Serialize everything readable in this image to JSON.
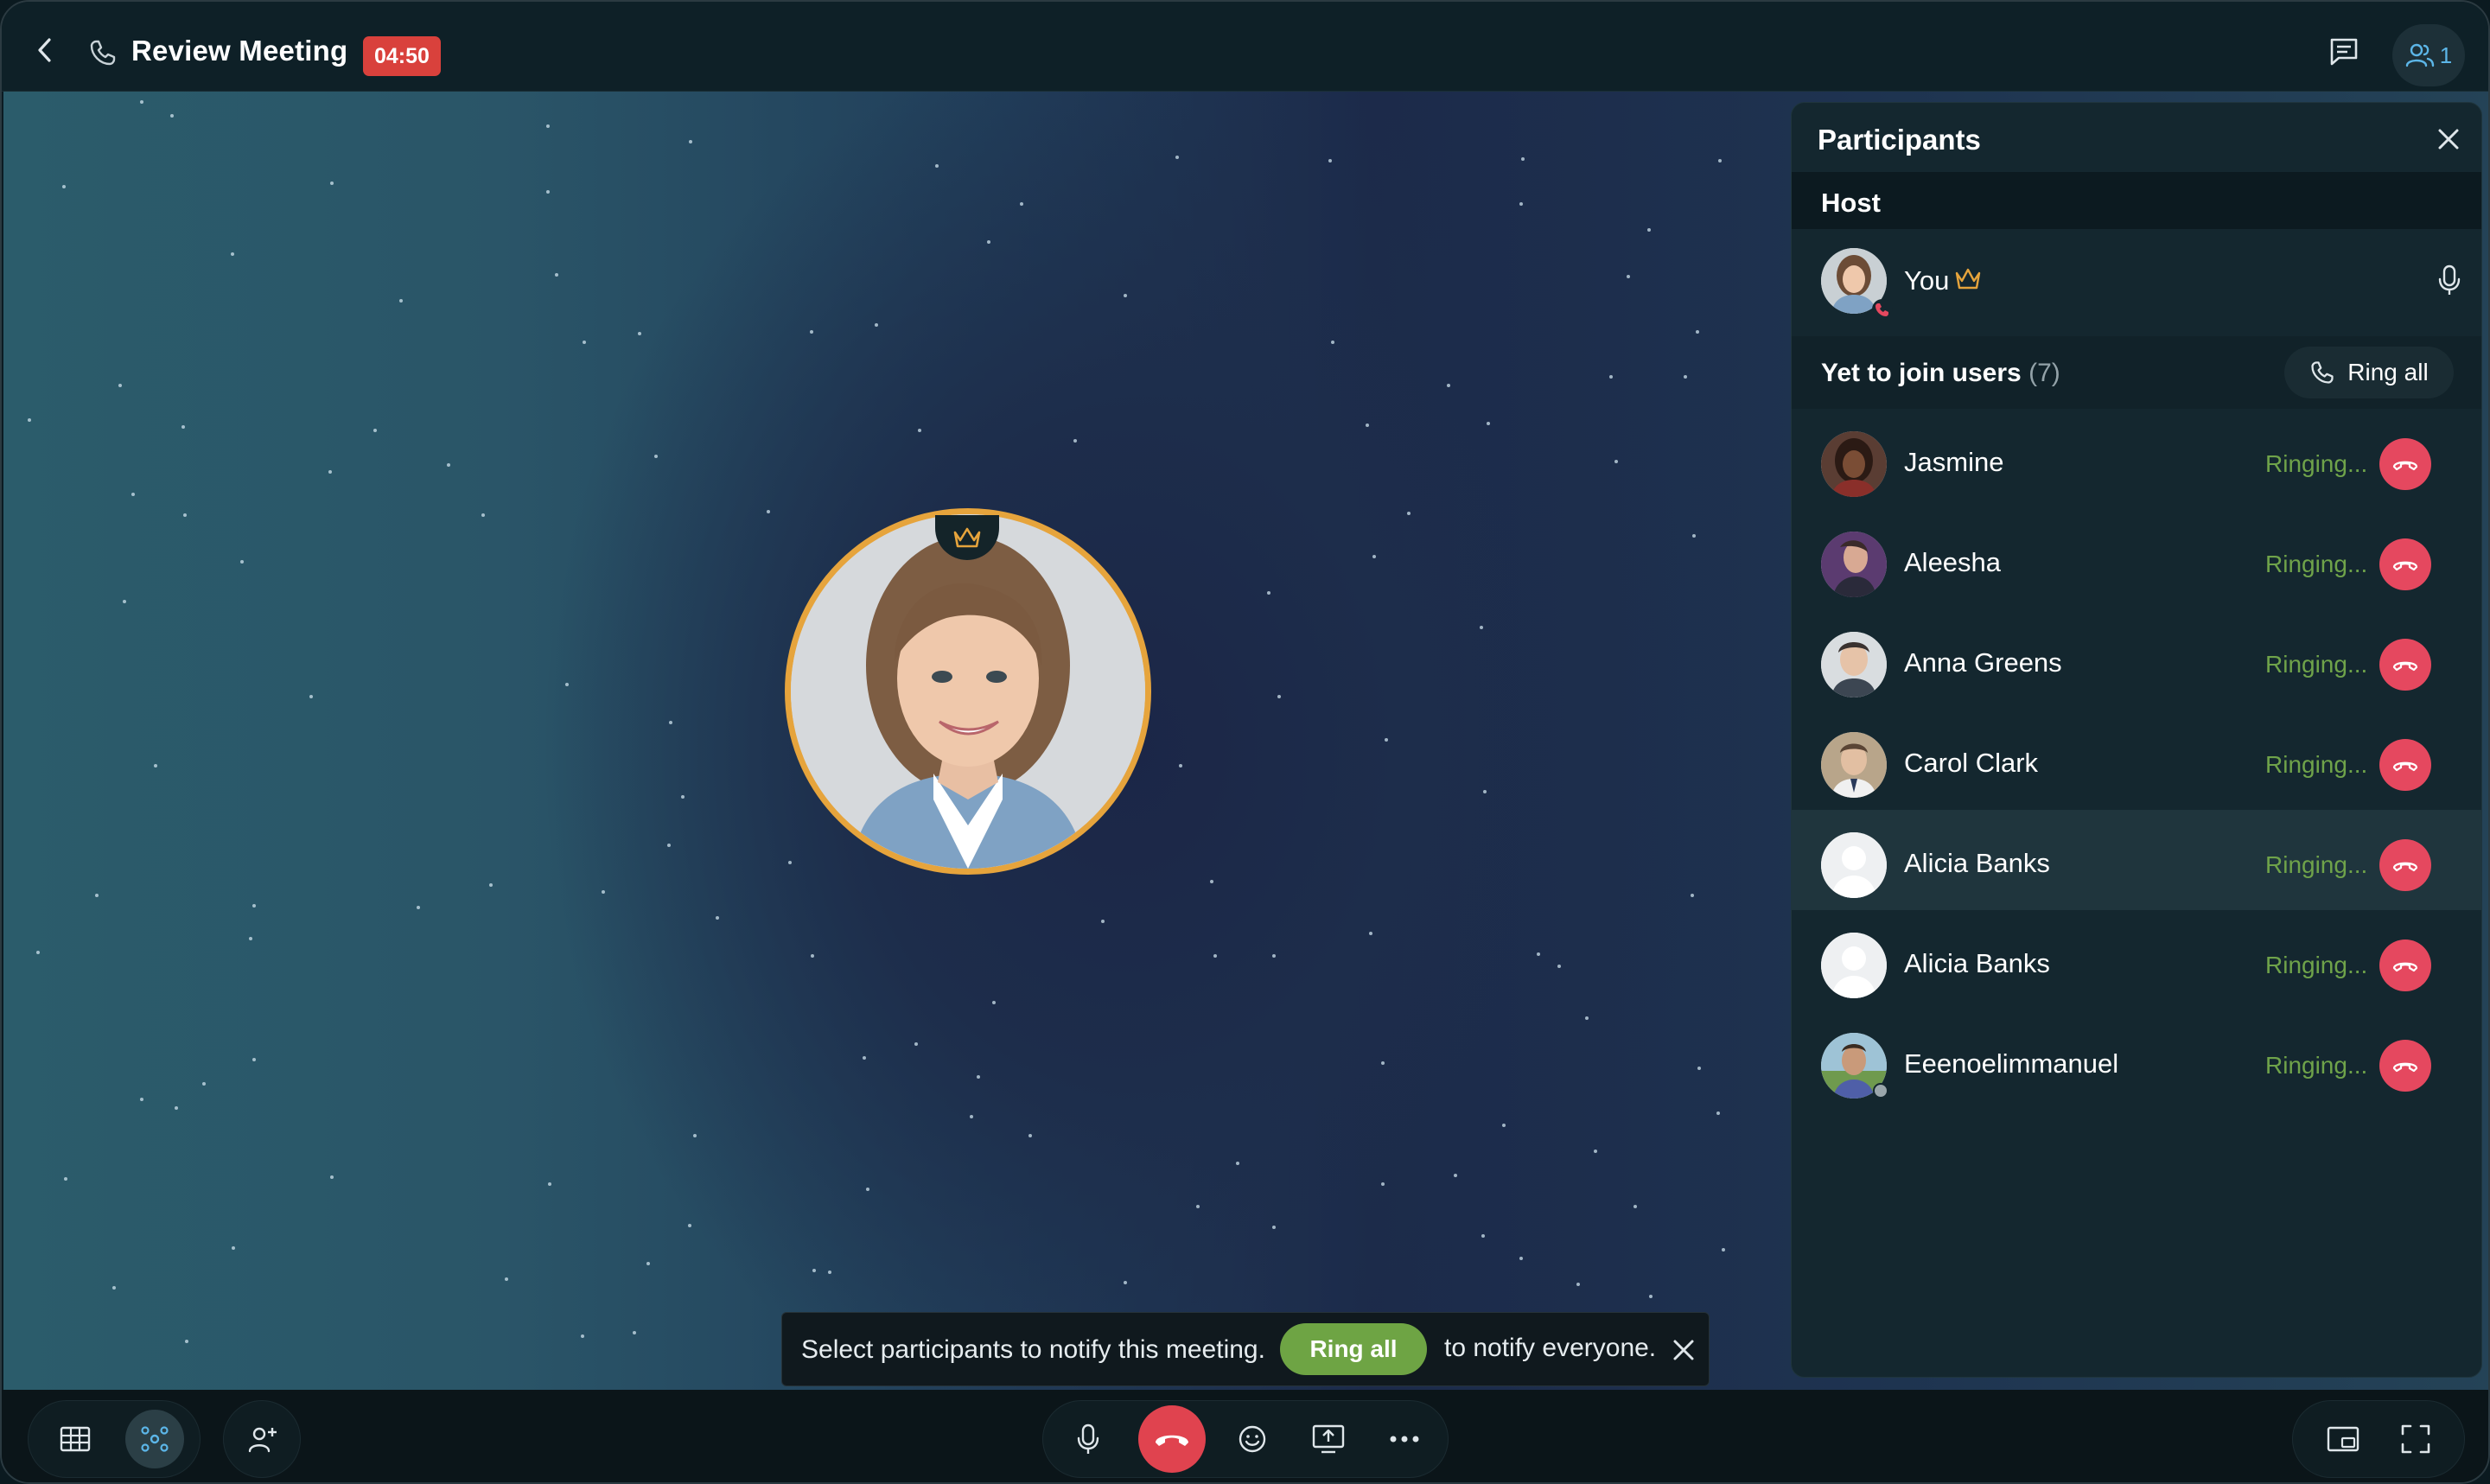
{
  "header": {
    "title": "Review Meeting",
    "timer": "04:50",
    "participants_count": "1",
    "icons": [
      "back-arrow-icon",
      "phone-icon",
      "chat-icon",
      "users-icon"
    ]
  },
  "stage": {
    "host_badge_icon": "crown-icon",
    "ring_color": "#e6a43c"
  },
  "toast": {
    "text_before": "Select participants to notify this meeting.",
    "ring_all_label": "Ring all",
    "text_after": "to notify everyone."
  },
  "panel": {
    "title": "Participants",
    "host_section": "Host",
    "host": {
      "name": "You",
      "icons": [
        "crown-icon",
        "mic-icon"
      ]
    },
    "yet_to_join_label": "Yet to join users",
    "yet_to_join_count": "(7)",
    "ring_all_label": "Ring all",
    "users": [
      {
        "name": "Jasmine",
        "status": "Ringing..."
      },
      {
        "name": "Aleesha",
        "status": "Ringing..."
      },
      {
        "name": "Anna Greens",
        "status": "Ringing..."
      },
      {
        "name": "Carol Clark",
        "status": "Ringing..."
      },
      {
        "name": "Alicia Banks",
        "status": "Ringing..."
      },
      {
        "name": "Alicia Banks",
        "status": "Ringing..."
      },
      {
        "name": "Eeenoelimmanuel",
        "status": "Ringing..."
      }
    ]
  },
  "colors": {
    "accent_green": "#6ea444",
    "status_ringing": "#6fa34a",
    "decline_red": "#e5485f",
    "timer_red": "#d9413c",
    "link_blue": "#5cb6e8"
  },
  "bottombar": {
    "left_icons": [
      "grid-view-icon",
      "network-view-icon",
      "add-participant-icon"
    ],
    "center_icons": [
      "mic-icon",
      "end-call-icon",
      "emoji-icon",
      "screen-share-icon",
      "more-icon"
    ],
    "right_icons": [
      "picture-in-picture-icon",
      "fullscreen-icon"
    ]
  }
}
